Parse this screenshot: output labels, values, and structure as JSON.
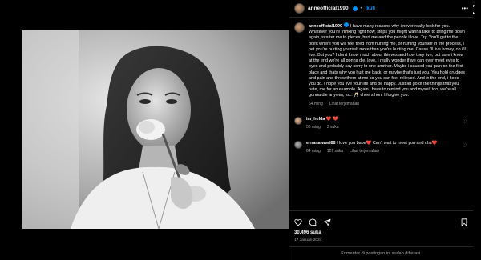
{
  "post": {
    "username": "anneofficial1990",
    "follow_label": "Ikuti",
    "separator": "•",
    "caption": "I have many reasons why i never really look for you. Whatever you're thinking right now, steps you might wanna take to bring me down again, scatter me to pieces, hurt me and the people i love. Try. You'll get to the point where you will feel tired from hurting me, or hurting yourself in the process, i bet you're hurting yourself more than you're hurting me. Cause i'll live honey, oh i'll live. But you? I don't know much about thieves and how they live, but sure i know at the end we're all gonna die, love. I really wonder if we can ever meet eyes to eyes and probably say sorry to one another. Maybe i caused you pain on the first place and thats why you hurt me back, or maybe that's just you. You hold grudges and pain and threw them at me so you can feel relieved. And in the end, i hope you do. I hope you live your life and be happy. Just let go of the things that you hate, me for an example. Again i have to remind you and myself too, we're all gonna die anyway, so.. 🥂 cheers hon. I forgive you.",
    "caption_time": "64 ming",
    "see_translation": "Lihat terjemahan",
    "likes": "30.496 suka",
    "date": "17 Januari 2024",
    "comments_disabled": "Komentar di postingan ini sudah dibatasi."
  },
  "comments": [
    {
      "username": "im_helda",
      "text": "❤️ ❤️",
      "time": "56 ming",
      "likes": "3 suka",
      "translate": ""
    },
    {
      "username": "ernanawawi88",
      "text": "I love you babe❤️ Can't wait to meet you and cha❤️",
      "time": "64 ming",
      "likes": "129 suka",
      "translate": "Lihat terjemahan"
    }
  ],
  "icons": {
    "close": "close-icon",
    "more": "more-icon",
    "like": "heart-icon",
    "comment": "comment-icon",
    "share": "send-icon",
    "save": "bookmark-icon"
  }
}
